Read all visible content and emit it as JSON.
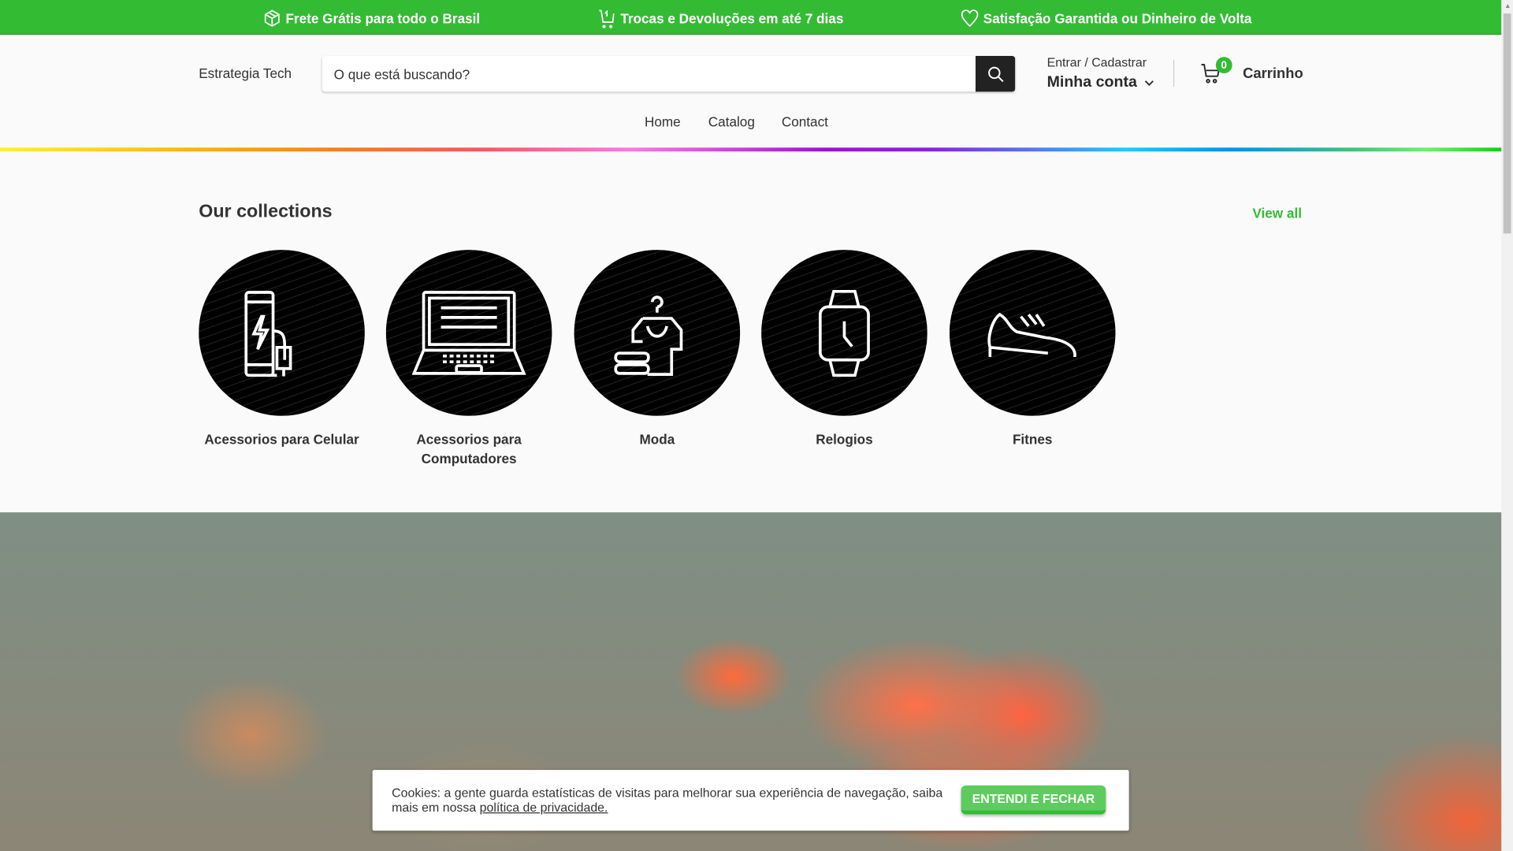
{
  "topbar": {
    "items": [
      {
        "icon": "box-icon",
        "label": "Frete Grátis para todo o Brasil"
      },
      {
        "icon": "cart-return-icon",
        "label": "Trocas e Devoluções em até 7 dias"
      },
      {
        "icon": "heart-icon",
        "label": "Satisfação Garantida ou Dinheiro de Volta"
      }
    ]
  },
  "header": {
    "logo": "Estrategia Tech",
    "search_placeholder": "O que está buscando?",
    "account_top": "Entrar / Cadastrar",
    "account": "Minha conta",
    "cart_count": "0",
    "cart_label": "Carrinho"
  },
  "nav": [
    "Home",
    "Catalog",
    "Contact"
  ],
  "collections": {
    "title": "Our collections",
    "view_all": "View all",
    "items": [
      {
        "label": "Acessorios para Celular",
        "icon": "phone-charger-icon"
      },
      {
        "label": "Acessorios para Computadores",
        "icon": "laptop-icon"
      },
      {
        "label": "Moda",
        "icon": "clothes-hanger-icon"
      },
      {
        "label": "Relogios",
        "icon": "smartwatch-icon"
      },
      {
        "label": "Fitnes",
        "icon": "sneaker-icon"
      }
    ]
  },
  "cookie": {
    "text": "Cookies: a gente guarda estatísticas de visitas para melhorar sua experiência de navegação, saiba mais em nossa ",
    "link": "política de privacidade.",
    "button": "ENTENDI E FECHAR"
  },
  "colors": {
    "brand": "#34bb34",
    "dark": "#222222"
  }
}
